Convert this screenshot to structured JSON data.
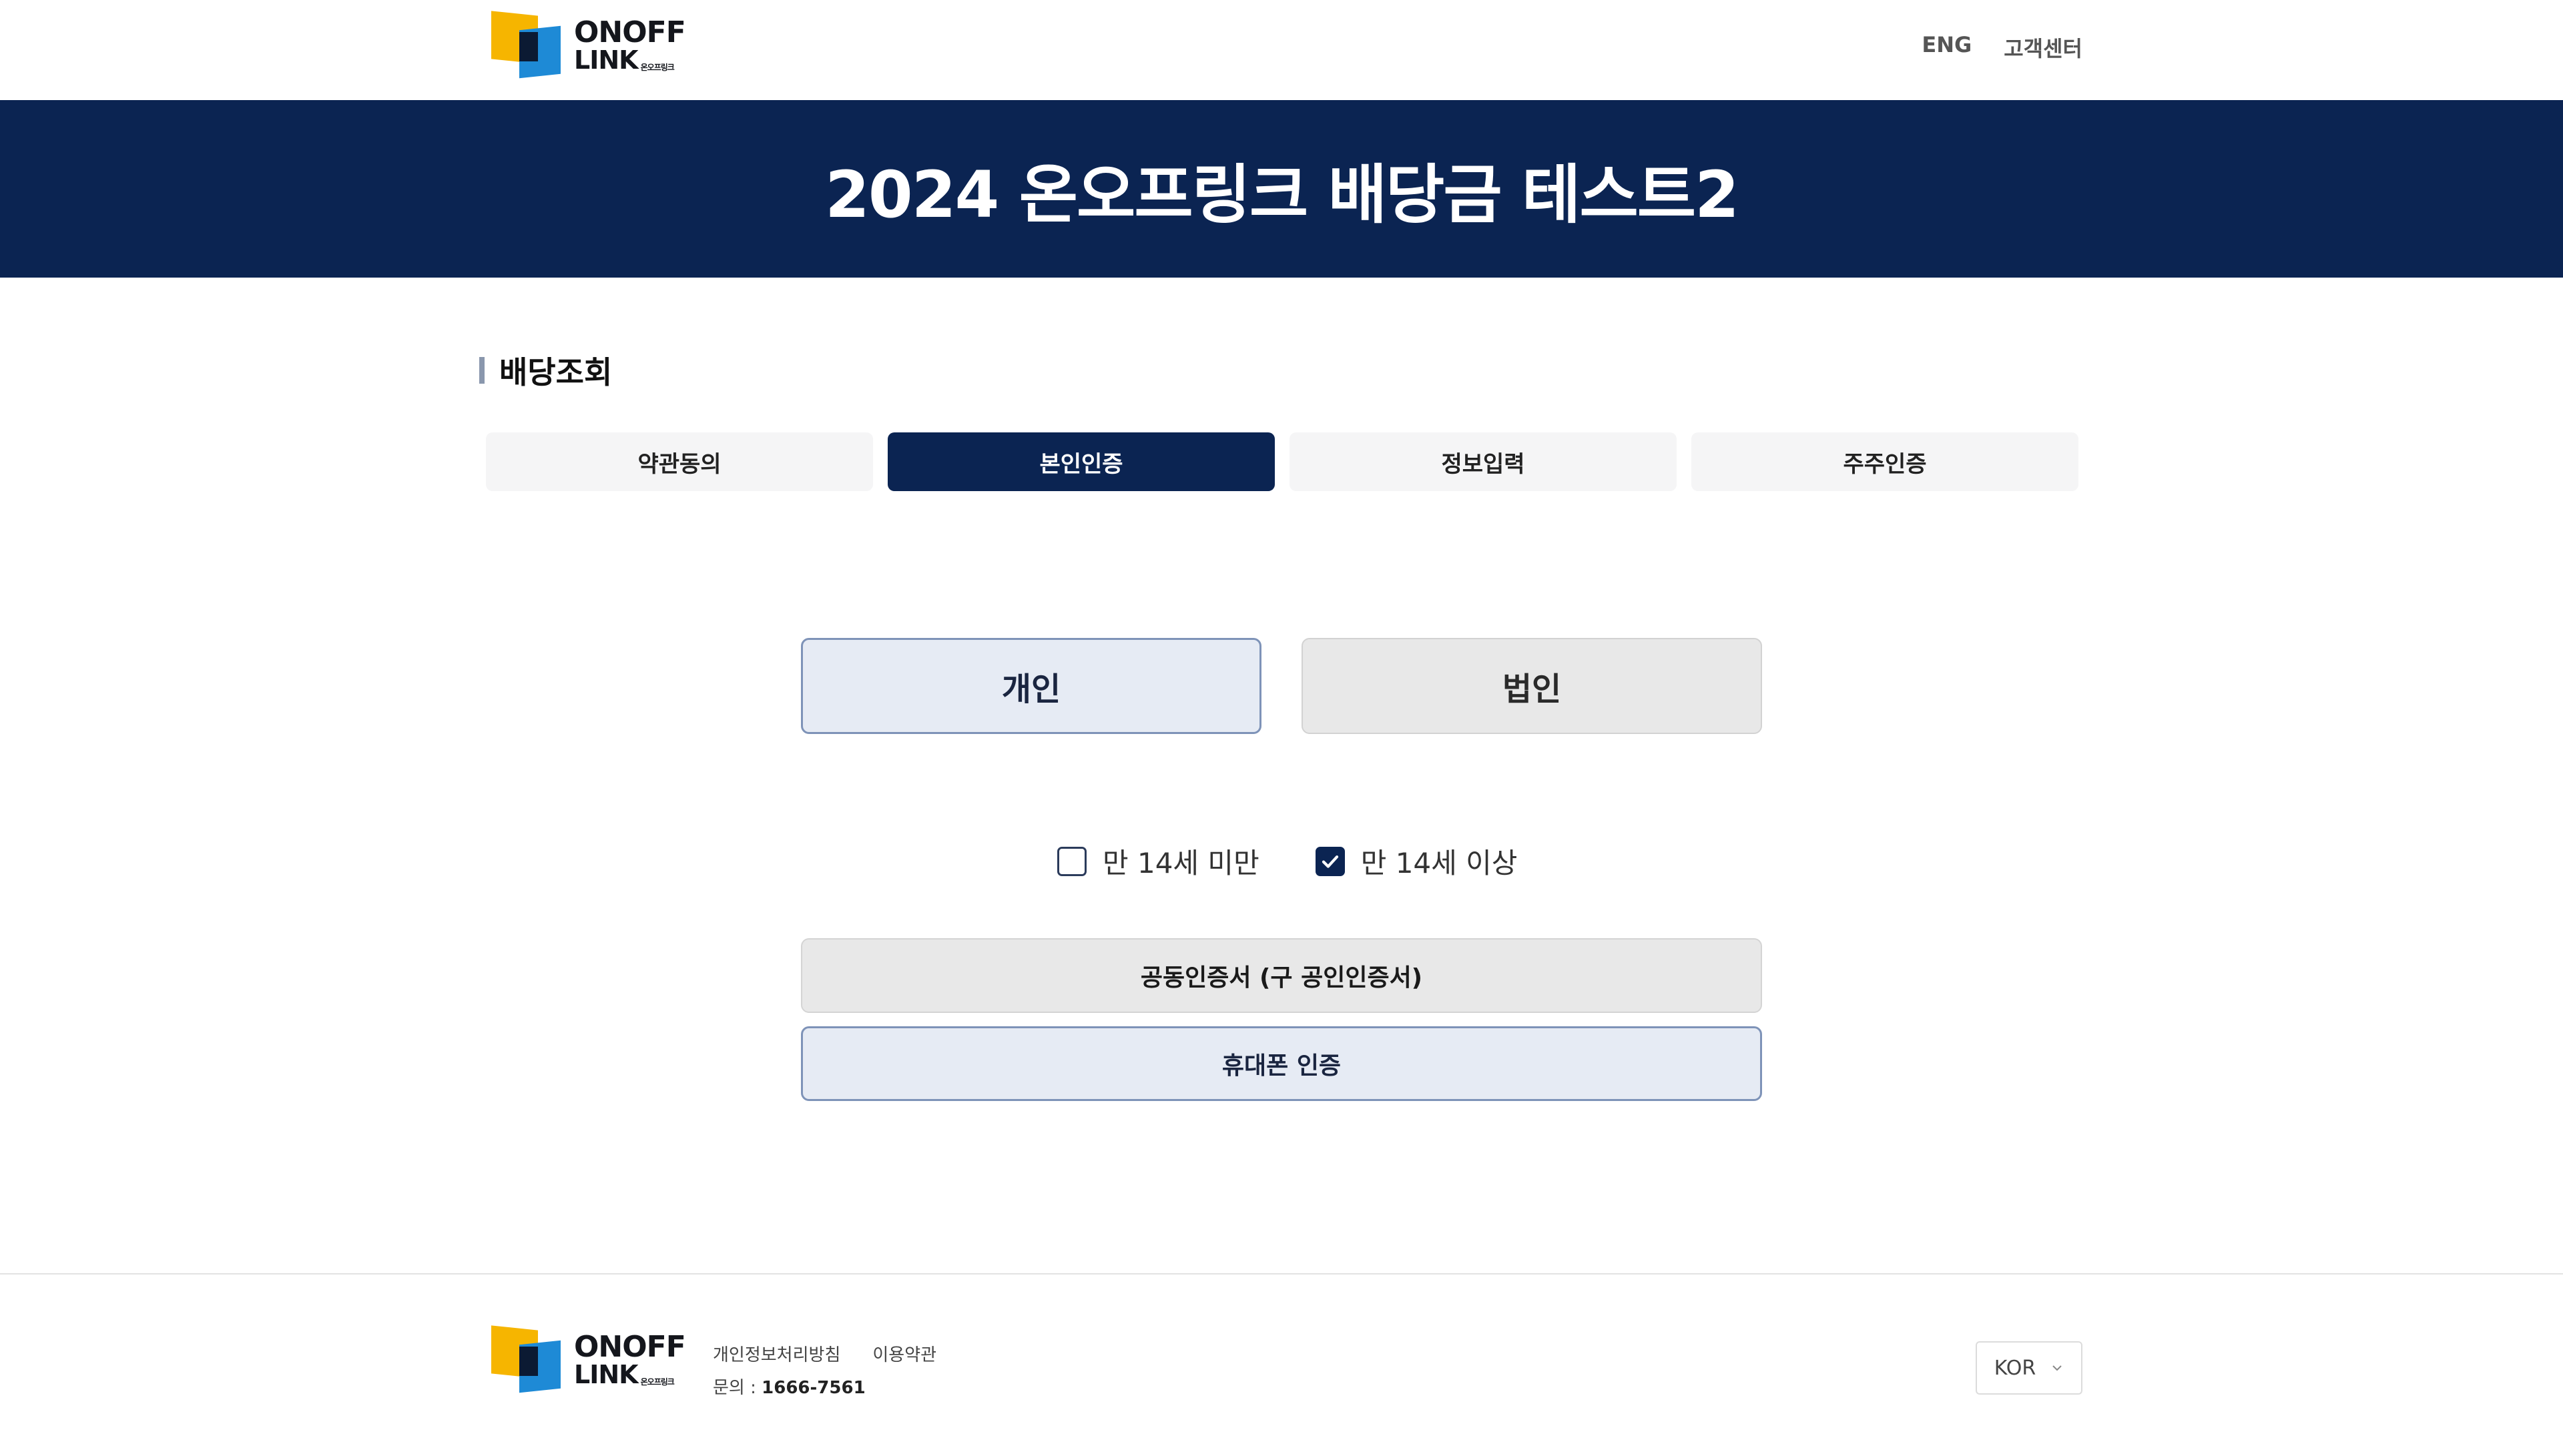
{
  "header": {
    "logo": {
      "line1": "ONOFF",
      "line2": "LINK",
      "small": "온오프링크"
    },
    "nav": {
      "eng": "ENG",
      "support": "고객센터"
    }
  },
  "banner": {
    "title": "2024 온오프링크 배당금 테스트2"
  },
  "section": {
    "title": "배당조회"
  },
  "steps": [
    {
      "label": "약관동의",
      "active": false
    },
    {
      "label": "본인인증",
      "active": true
    },
    {
      "label": "정보입력",
      "active": false
    },
    {
      "label": "주주인증",
      "active": false
    }
  ],
  "type": {
    "personal": "개인",
    "corporate": "법인",
    "selected": "개인"
  },
  "age": {
    "under": "만 14세 미만",
    "over": "만 14세 이상",
    "checked": "over"
  },
  "auth": {
    "certificate": "공동인증서 (구 공인인증서)",
    "phone": "휴대폰 인증"
  },
  "footer": {
    "privacy": "개인정보처리방침",
    "terms": "이용약관",
    "contact_label": "문의 : ",
    "contact_number": "1666-7561",
    "language": "KOR"
  },
  "colors": {
    "navy": "#0b2452",
    "accent_yellow": "#f6b500",
    "accent_blue": "#1e8ad6"
  }
}
